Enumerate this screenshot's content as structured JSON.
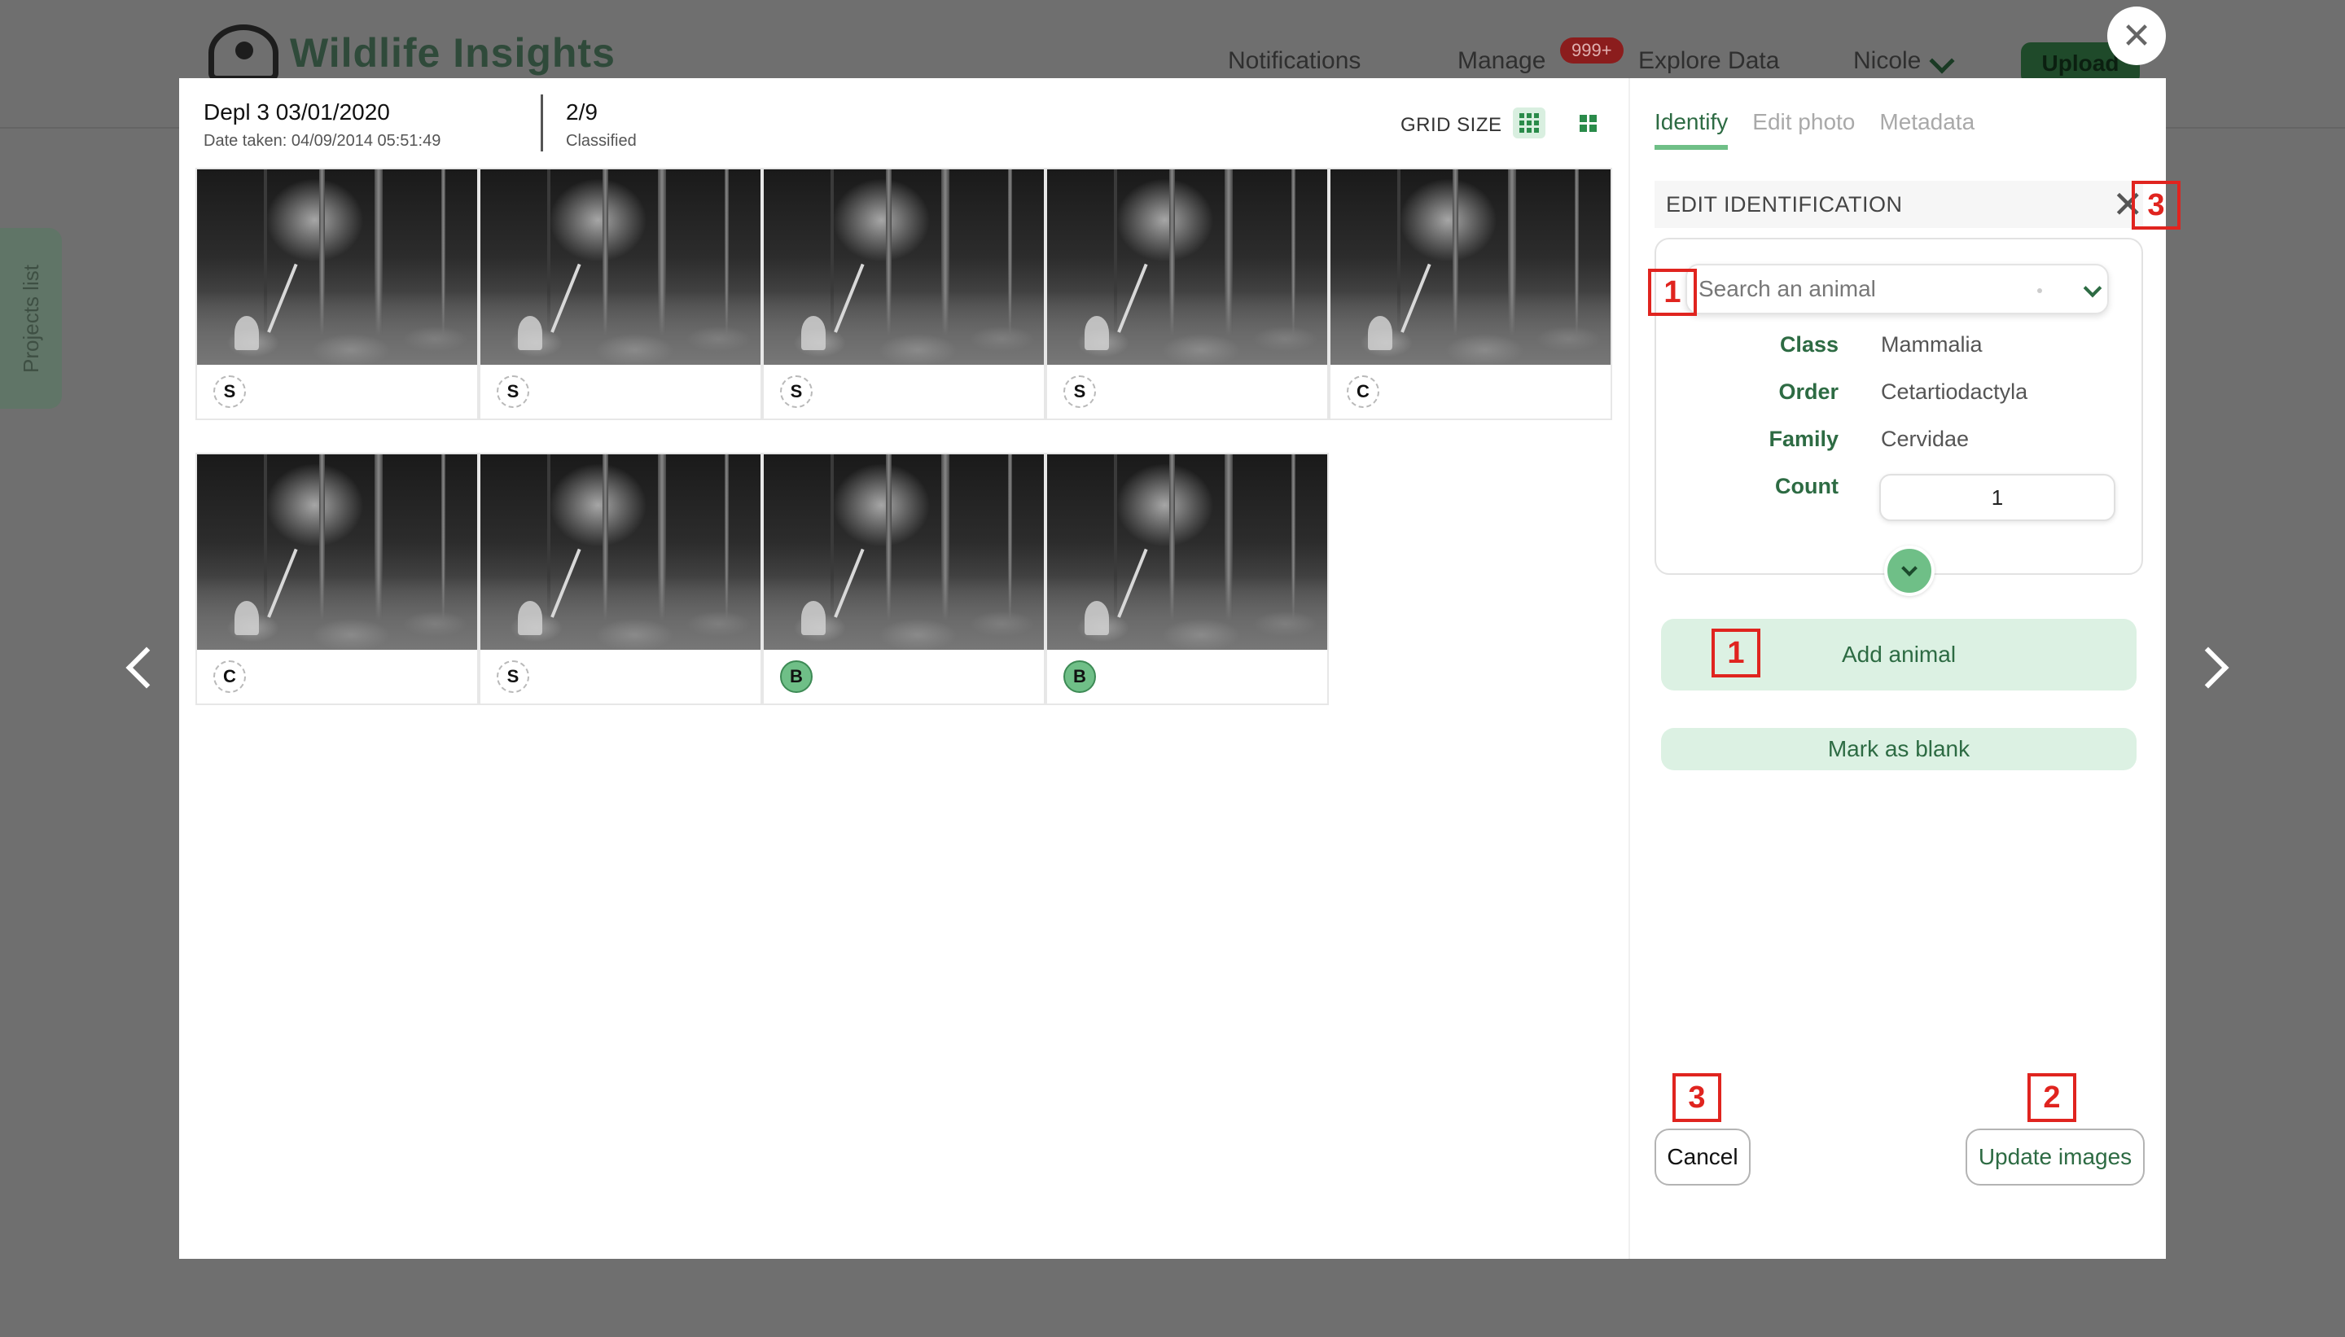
{
  "background_app": {
    "logo_text": "Wildlife Insights",
    "nav": {
      "notifications": "Notifications",
      "manage": "Manage",
      "badge": "999+",
      "explore": "Explore Data",
      "user": "Nicole",
      "upload": "Upload"
    },
    "projects_tab": "Projects list"
  },
  "gallery": {
    "deployment_title": "Depl 3 03/01/2020",
    "date_taken": "Date taken: 04/09/2014 05:51:49",
    "count": "2/9",
    "count_caption": "Classified",
    "grid_size_label": "GRID SIZE",
    "rows": [
      [
        {
          "tag": "S",
          "state": "identified"
        },
        {
          "tag": "S",
          "state": "identified"
        },
        {
          "tag": "S",
          "state": "identified"
        },
        {
          "tag": "S",
          "state": "identified"
        },
        {
          "tag": "C",
          "state": "identified"
        }
      ],
      [
        {
          "tag": "C",
          "state": "identified"
        },
        {
          "tag": "S",
          "state": "identified"
        },
        {
          "tag": "B",
          "state": "blank"
        },
        {
          "tag": "B",
          "state": "blank"
        }
      ]
    ]
  },
  "panel": {
    "tabs": [
      "Identify",
      "Edit photo",
      "Metadata"
    ],
    "edit_title": "EDIT IDENTIFICATION",
    "close_glyph": "✕",
    "search_placeholder": "Search an animal",
    "taxonomy": {
      "class_label": "Class",
      "class_value": "Mammalia",
      "order_label": "Order",
      "order_value": "Cetartiodactyla",
      "family_label": "Family",
      "family_value": "Cervidae",
      "count_label": "Count",
      "count_value": "1"
    },
    "add_animal": "Add animal",
    "mark_blank": "Mark as blank",
    "cancel": "Cancel",
    "update": "Update images"
  },
  "markers": [
    "1",
    "1",
    "2",
    "3",
    "3"
  ],
  "colors": {
    "accent_green": "#2d6b43",
    "light_green": "#dcf1e3",
    "blank_tag": "#6fbf87",
    "annotation_red": "#e0241f",
    "badge_red": "#8b1d1d"
  }
}
